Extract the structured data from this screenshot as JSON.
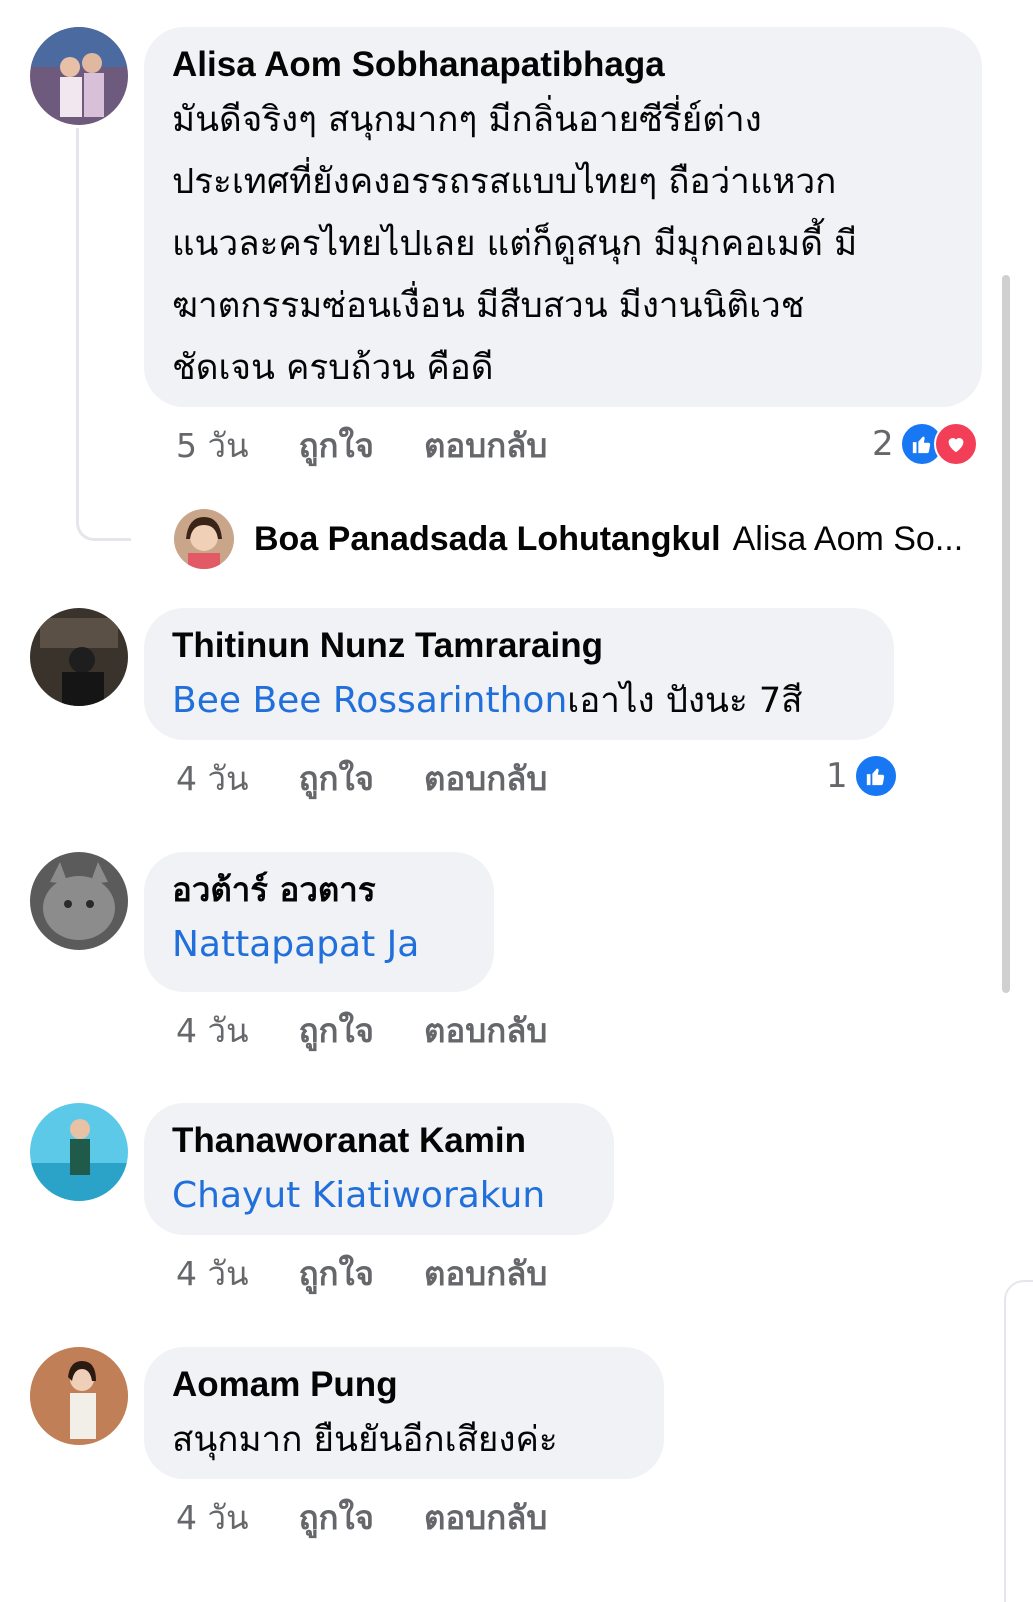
{
  "comments": [
    {
      "author": "Alisa Aom Sobhanapatibhaga",
      "lines": [
        "มันดีจริงๆ สนุกมากๆ มีกลิ่นอายซีรี่ย์ต่าง",
        "ประเทศที่ยังคงอรรถรสแบบไทยๆ ถือว่าแหวก",
        "แนวละครไทยไปเลย แต่ก็ดูสนุก มีมุกคอเมดี้ มี",
        "ฆาตกรรมซ่อนเงื่อน มีสืบสวน มีงานนิติเวช",
        "ชัดเจน ครบถ้วน คือดี"
      ],
      "time": "5 วัน",
      "like_label": "ถูกใจ",
      "reply_label": "ตอบกลับ",
      "reaction_count": "2",
      "reactions": [
        "like-icon",
        "love-icon"
      ]
    },
    {
      "author": "Thitinun Nunz Tamraraing",
      "mention": "Bee Bee Rossarinthon",
      "text": "เอาไง ปังนะ 7สี",
      "time": "4 วัน",
      "like_label": "ถูกใจ",
      "reply_label": "ตอบกลับ",
      "reaction_count": "1",
      "reactions": [
        "like-icon"
      ]
    },
    {
      "author": "อวต้าร์ อวตาร",
      "mention": "Nattapapat Ja",
      "time": "4 วัน",
      "like_label": "ถูกใจ",
      "reply_label": "ตอบกลับ"
    },
    {
      "author": "Thanaworanat Kamin",
      "mention": "Chayut Kiatiworakun",
      "time": "4 วัน",
      "like_label": "ถูกใจ",
      "reply_label": "ตอบกลับ"
    },
    {
      "author": "Aomam Pung",
      "text": "สนุกมาก ยืนยันอีกเสียงค่ะ",
      "time": "4 วัน",
      "like_label": "ถูกใจ",
      "reply_label": "ตอบกลับ"
    }
  ],
  "reply_preview": {
    "author": "Boa Panadsada Lohutangkul",
    "text": "Alisa Aom So..."
  },
  "colors": {
    "bubble": "#f0f2f5",
    "mention": "#216fdb",
    "meta": "#65676b",
    "like": "#1877f2",
    "love": "#f33e58"
  }
}
